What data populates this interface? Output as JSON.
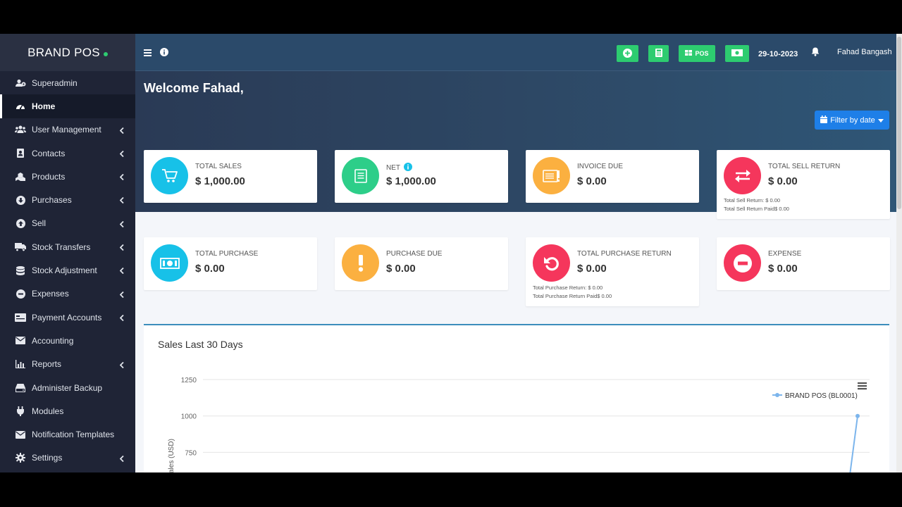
{
  "brand": {
    "name": "BRAND POS"
  },
  "sidebar": {
    "items": [
      {
        "label": "Superadmin",
        "icon": "users-cog-icon",
        "chevron": false,
        "active": false
      },
      {
        "label": "Home",
        "icon": "dashboard-gauge-icon",
        "chevron": false,
        "active": true
      },
      {
        "label": "User Management",
        "icon": "users-icon",
        "chevron": true,
        "active": false
      },
      {
        "label": "Contacts",
        "icon": "address-book-icon",
        "chevron": true,
        "active": false
      },
      {
        "label": "Products",
        "icon": "cubes-icon",
        "chevron": true,
        "active": false
      },
      {
        "label": "Purchases",
        "icon": "arrow-circle-down-icon",
        "chevron": true,
        "active": false
      },
      {
        "label": "Sell",
        "icon": "arrow-circle-up-icon",
        "chevron": true,
        "active": false
      },
      {
        "label": "Stock Transfers",
        "icon": "truck-icon",
        "chevron": true,
        "active": false
      },
      {
        "label": "Stock Adjustment",
        "icon": "database-icon",
        "chevron": true,
        "active": false
      },
      {
        "label": "Expenses",
        "icon": "minus-circle-icon",
        "chevron": true,
        "active": false
      },
      {
        "label": "Payment Accounts",
        "icon": "money-check-icon",
        "chevron": true,
        "active": false
      },
      {
        "label": "Accounting",
        "icon": "envelope-icon",
        "chevron": false,
        "active": false
      },
      {
        "label": "Reports",
        "icon": "bar-chart-icon",
        "chevron": true,
        "active": false
      },
      {
        "label": "Administer Backup",
        "icon": "hdd-icon",
        "chevron": false,
        "active": false
      },
      {
        "label": "Modules",
        "icon": "plug-icon",
        "chevron": false,
        "active": false
      },
      {
        "label": "Notification Templates",
        "icon": "envelope-icon",
        "chevron": false,
        "active": false
      },
      {
        "label": "Settings",
        "icon": "gear-icon",
        "chevron": true,
        "active": false
      }
    ]
  },
  "header": {
    "pos_label": "POS",
    "date": "29-10-2023",
    "user": "Fahad Bangash"
  },
  "welcome": "Welcome Fahad,",
  "filter_label": "Filter by date",
  "cards_row1": [
    {
      "label": "TOTAL SALES",
      "value": "$ 1,000.00",
      "color": "#17c1e8",
      "icon": "cart-icon"
    },
    {
      "label": "NET",
      "value": "$ 1,000.00",
      "color": "#2dce89",
      "icon": "invoice-icon",
      "info": true
    },
    {
      "label": "INVOICE DUE",
      "value": "$ 0.00",
      "color": "#fbb040",
      "icon": "invoice-alert-icon"
    },
    {
      "label": "TOTAL SELL RETURN",
      "value": "$ 0.00",
      "color": "#f5365c",
      "icon": "exchange-icon",
      "notes": [
        "Total Sell Return: $ 0.00",
        "Total Sell Return Paid$ 0.00"
      ]
    }
  ],
  "cards_row2": [
    {
      "label": "TOTAL PURCHASE",
      "value": "$ 0.00",
      "color": "#17c1e8",
      "icon": "money-bill-icon"
    },
    {
      "label": "PURCHASE DUE",
      "value": "$ 0.00",
      "color": "#fbb040",
      "icon": "exclamation-icon"
    },
    {
      "label": "TOTAL PURCHASE RETURN",
      "value": "$ 0.00",
      "color": "#f5365c",
      "icon": "undo-icon",
      "notes": [
        "Total Purchase Return: $ 0.00",
        "Total Purchase Return Paid$ 0.00"
      ]
    },
    {
      "label": "EXPENSE",
      "value": "$ 0.00",
      "color": "#f5365c",
      "icon": "minus-circle-icon"
    }
  ],
  "chart": {
    "title": "Sales Last 30 Days",
    "ylabel": "ales (USD)",
    "legend": "BRAND POS (BL0001)",
    "series_color": "#7cb5ec"
  },
  "chart_data": {
    "type": "line",
    "title": "Sales Last 30 Days",
    "ylabel": "ales (USD)",
    "ylim": [
      0,
      1250
    ],
    "yticks": [
      1250,
      1000,
      750
    ],
    "grid": true,
    "legend_position": "top-right",
    "series": [
      {
        "name": "BRAND POS (BL0001)",
        "values": [
          1000
        ]
      }
    ]
  }
}
